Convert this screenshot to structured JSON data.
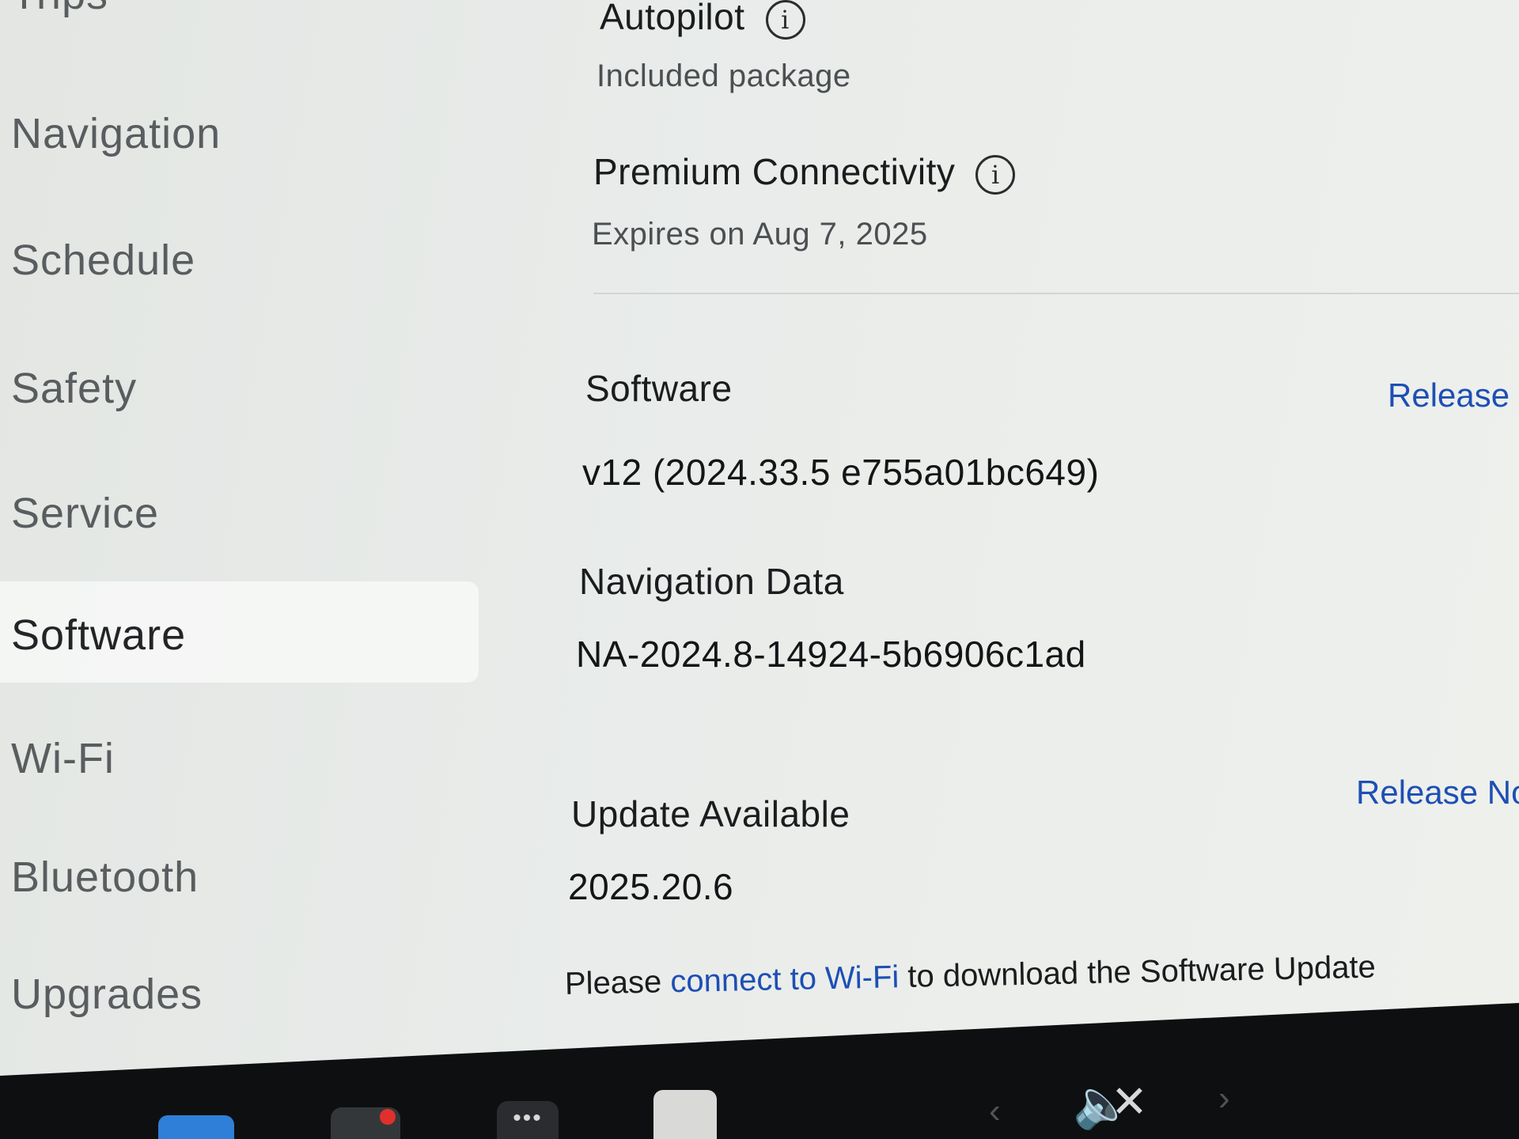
{
  "sidebar": {
    "items": [
      {
        "label": "Trips"
      },
      {
        "label": "Navigation"
      },
      {
        "label": "Schedule"
      },
      {
        "label": "Safety"
      },
      {
        "label": "Service"
      },
      {
        "label": "Software"
      },
      {
        "label": "Wi-Fi"
      },
      {
        "label": "Bluetooth"
      },
      {
        "label": "Upgrades"
      }
    ],
    "active": "Software"
  },
  "main": {
    "autopilot": {
      "title": "Autopilot",
      "subtitle": "Included package"
    },
    "premium_connectivity": {
      "title": "Premium Connectivity",
      "subtitle": "Expires on Aug 7, 2025"
    },
    "software": {
      "title": "Software",
      "version": "v12 (2024.33.5 e755a01bc649)",
      "release_notes_label": "Release N"
    },
    "navigation_data": {
      "title": "Navigation Data",
      "value": "NA-2024.8-14924-5b6906c1ad"
    },
    "update": {
      "title": "Update Available",
      "version": "2025.20.6",
      "release_notes_label": "Release No",
      "notice_prefix": "Please ",
      "notice_link": "connect to Wi-Fi",
      "notice_suffix": " to download the Software Update"
    }
  },
  "taskbar": {
    "icons": [
      "phone-icon",
      "camera-icon",
      "more-icon",
      "notes-icon",
      "chevron-left-icon",
      "volume-muted-icon",
      "chevron-right-icon"
    ],
    "more_glyph": "•••",
    "left_arrow": "‹",
    "right_arrow": "›",
    "volume_glyph": "🔈",
    "mute_glyph": "✕"
  },
  "colors": {
    "accent_link": "#1d4fb5",
    "panel_bg": "#e9ecea",
    "taskbar_bg": "#0e0f11"
  }
}
